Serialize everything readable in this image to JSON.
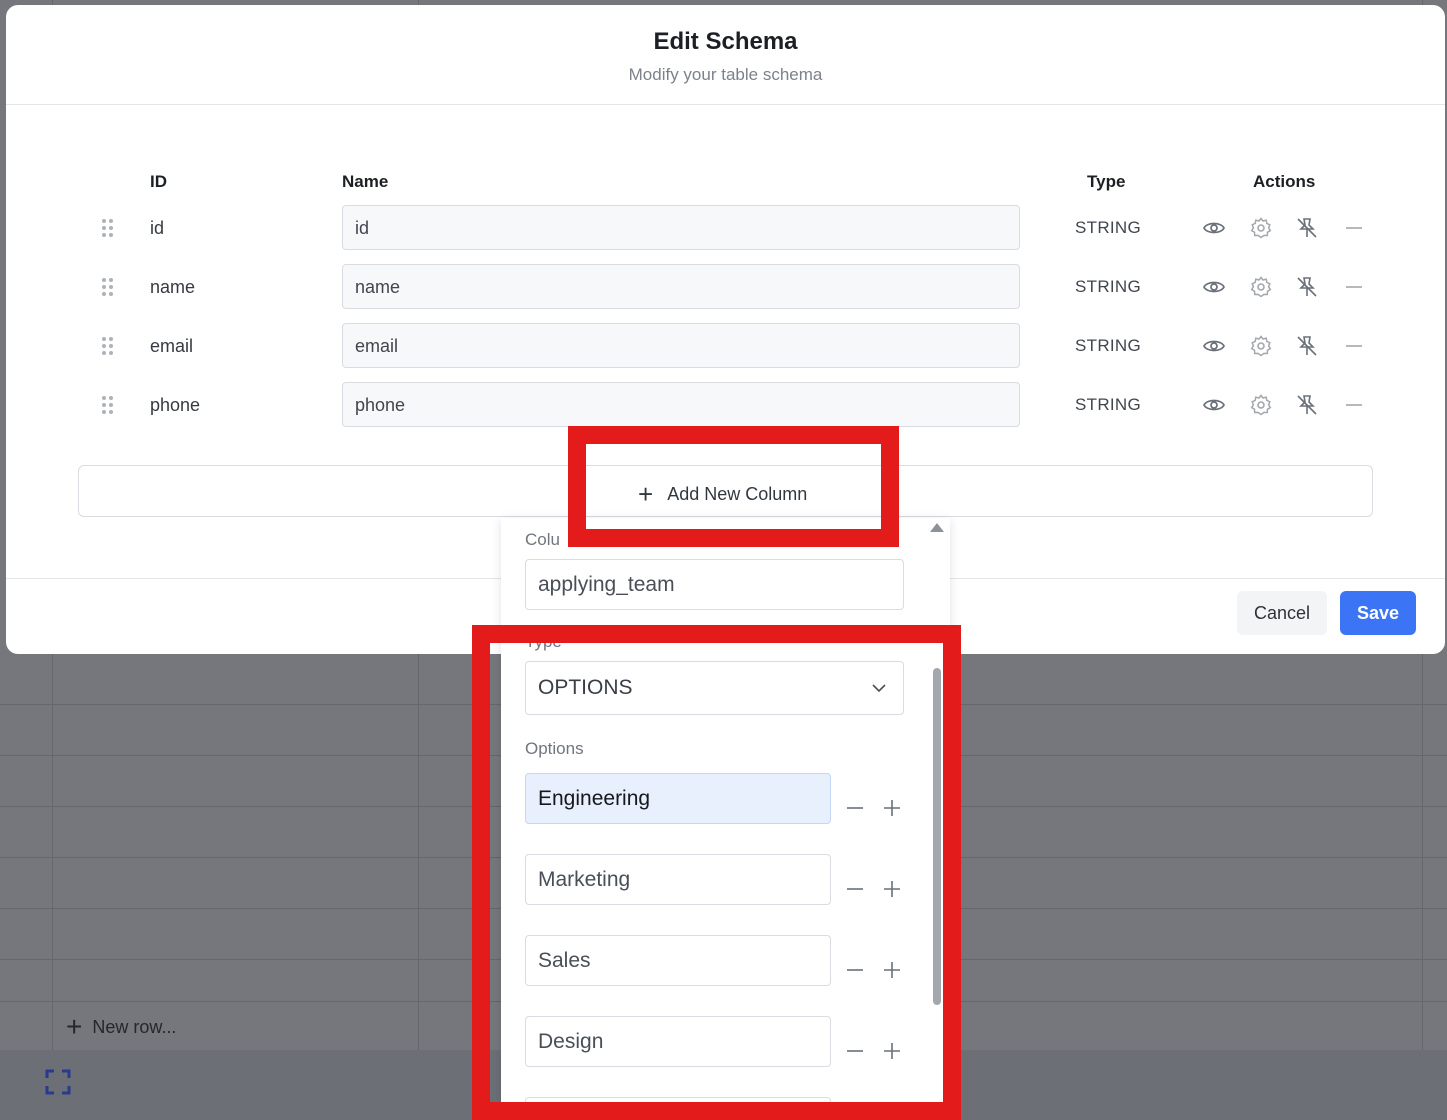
{
  "modal": {
    "title": "Edit Schema",
    "subtitle": "Modify your table schema"
  },
  "columns_header": {
    "id": "ID",
    "name": "Name",
    "type": "Type",
    "actions": "Actions"
  },
  "rows": [
    {
      "id": "id",
      "name": "id",
      "type": "STRING"
    },
    {
      "id": "name",
      "name": "name",
      "type": "STRING"
    },
    {
      "id": "email",
      "name": "email",
      "type": "STRING"
    },
    {
      "id": "phone",
      "name": "phone",
      "type": "STRING"
    }
  ],
  "row_actions": [
    "eye-icon",
    "gear-icon",
    "unpin-icon",
    "minus-icon"
  ],
  "add_column": {
    "label": "Add New Column"
  },
  "new_column_panel": {
    "column_label": "Colu",
    "column_value": "applying_team",
    "type_label": "Type",
    "type_value": "OPTIONS",
    "options_label": "Options",
    "options": [
      "Engineering",
      "Marketing",
      "Sales",
      "Design"
    ]
  },
  "footer": {
    "cancel_label": "Cancel",
    "save_label": "Save"
  },
  "background": {
    "new_row_label": "New row..."
  },
  "colors": {
    "primary": "#3b74f5",
    "annotation_red": "#e31b1b",
    "overlay": "#74767d"
  }
}
